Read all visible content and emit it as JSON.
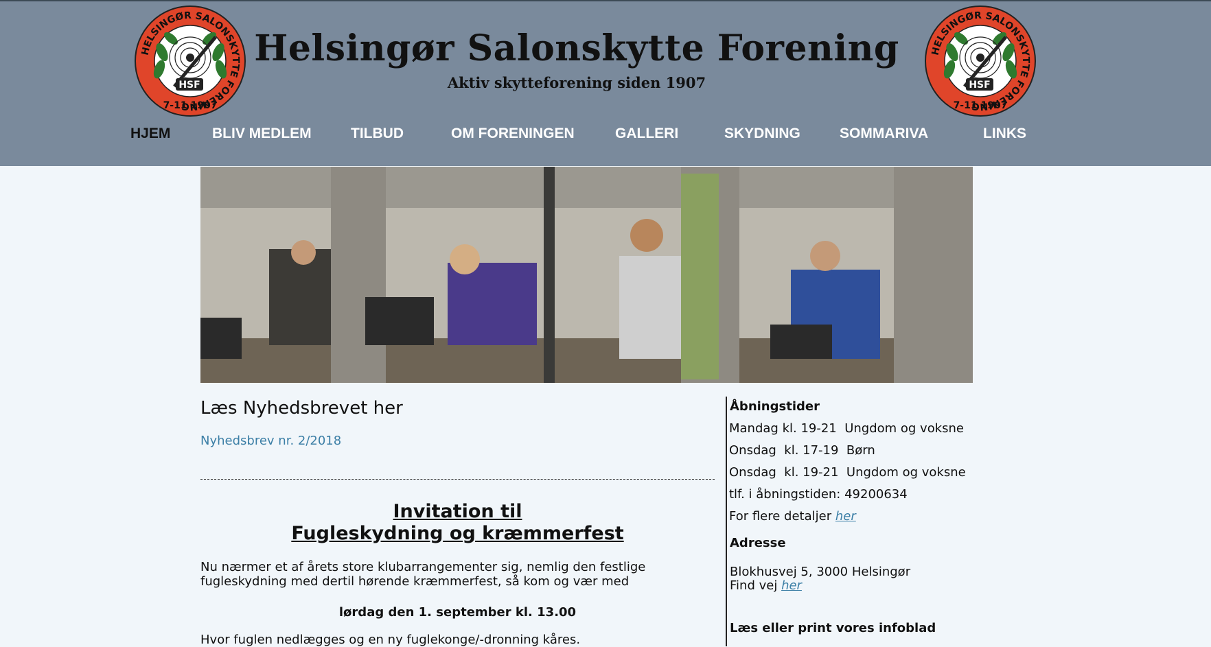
{
  "header": {
    "title": "Helsingør Salonskytte Forening",
    "subtitle": "Aktiv skytteforening siden 1907",
    "logo": {
      "ring_text": "HELSINGØR SALONSKYTTE FORENING",
      "center_text": "HSF",
      "date_text": "7-11  1907",
      "colors": {
        "ring": "#e0452a",
        "inner": "#ffffff",
        "leaf": "#2f7a2f",
        "text": "#111111"
      }
    }
  },
  "nav": {
    "items": [
      {
        "label": "HJEM",
        "active": true
      },
      {
        "label": "BLIV MEDLEM"
      },
      {
        "label": "TILBUD"
      },
      {
        "label": "OM FORENINGEN"
      },
      {
        "label": "GALLERI"
      },
      {
        "label": "SKYDNING"
      },
      {
        "label": "SOMMARIVA"
      },
      {
        "label": "LINKS"
      }
    ]
  },
  "main": {
    "newsletter_heading": "Læs Nyhedsbrevet her",
    "newsletter_link": "Nyhedsbrev nr. 2/2018",
    "invitation_title_line1": "Invitation til",
    "invitation_title_line2": "Fugleskydning og kræmmerfest",
    "invitation_body": "Nu nærmer et af årets store klubarrangementer sig, nemlig den festlige fugleskydning med dertil hørende kræmmerfest, så kom og vær med",
    "invitation_date": "lørdag den 1. september kl. 13.00",
    "invitation_more": "Hvor fuglen nedlægges og en ny fuglekonge/-dronning kåres."
  },
  "sidebar": {
    "hours_title": "Åbningstider",
    "hours": [
      "Mandag kl. 19-21  Ungdom og voksne",
      "Onsdag  kl. 17-19  Børn",
      "Onsdag  kl. 19-21  Ungdom og voksne",
      "tlf. i åbningstiden: 49200634"
    ],
    "details_prefix": "For flere detaljer ",
    "details_link": "her",
    "address_title": "Adresse",
    "address_line": "Blokhusvej 5, 3000 Helsingør",
    "directions_prefix": "Find vej ",
    "directions_link": "her",
    "infoblad_title": "Læs eller print vores infoblad"
  },
  "colors": {
    "header_bg": "#7a8a9c",
    "page_bg": "#f1f6fa",
    "link": "#3c7fa6",
    "nav_text": "#ffffff",
    "nav_active": "#111111"
  }
}
